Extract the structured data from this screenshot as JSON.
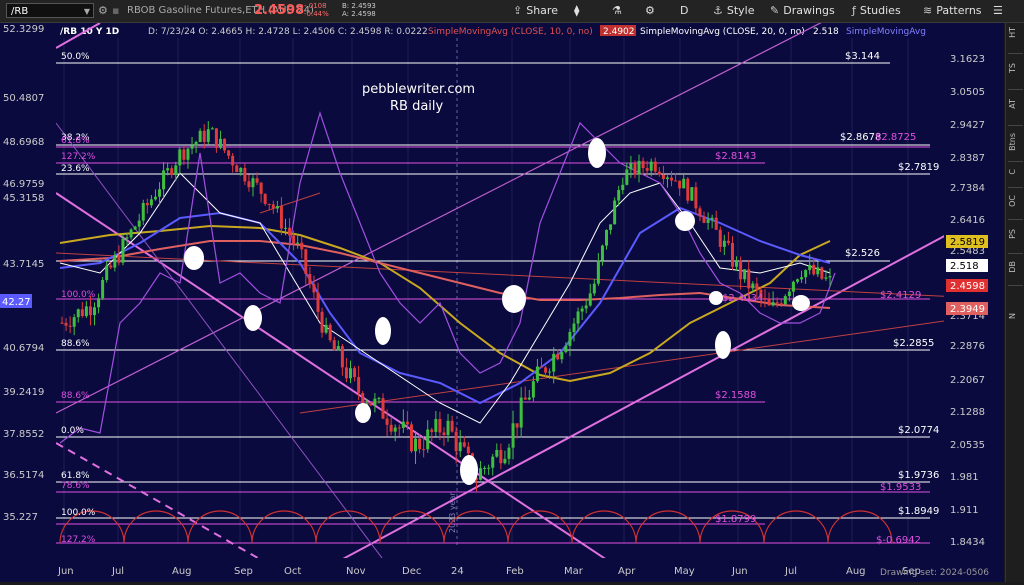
{
  "toolbar": {
    "symbol": "/RB",
    "instrument_title": "RBOB Gasoline Futures,ETH (AUG 24)",
    "last_price": "2.4598",
    "change": "-.0108",
    "change_pct": "-0.44%",
    "bid": "B: 2.4593",
    "ask": "A: 2.4598",
    "share_label": "Share",
    "period_label": "D",
    "style_label": "Style",
    "drawings_label": "Drawings",
    "studies_label": "Studies",
    "patterns_label": "Patterns"
  },
  "chart_header": {
    "symbol_tf": "/RB 10 Y 1D",
    "ohlc": "D: 7/23/24  O: 2.4665  H: 2.4728  L: 2.4506  C: 2.4598  R: 0.0222",
    "sma10": "SimpleMovingAvg (CLOSE, 10, 0, no)",
    "sma10_val": "2.4902",
    "sma20": "SimpleMovingAvg (CLOSE, 20, 0, no)",
    "sma20_val": "2.518",
    "sma_more": "SimpleMovingAvg"
  },
  "watermark": {
    "line1": "pebblewriter.com",
    "line2": "RB daily"
  },
  "chart_data": {
    "type": "candlestick",
    "x_labels": [
      "Jun",
      "Jul",
      "Aug",
      "Sep",
      "Oct",
      "Nov",
      "Dec",
      "24",
      "Feb",
      "Mar",
      "Apr",
      "May",
      "Jun",
      "Jul",
      "Aug",
      "Sep"
    ],
    "right_axis": [
      "3.1623",
      "3.0505",
      "2.9427",
      "2.8387",
      "2.7384",
      "2.6416",
      "2.5483",
      "2.3714",
      "2.2876",
      "2.2067",
      "2.1288",
      "2.0535",
      "1.981",
      "1.911",
      "1.8434"
    ],
    "left_axis": [
      "52.3299",
      "50.4807",
      "48.6968",
      "46.9759",
      "45.3158",
      "43.7145",
      "40.6794",
      "39.2419",
      "37.8552",
      "36.5174",
      "35.227"
    ],
    "left_marker": "42.27",
    "right_badges": {
      "sma_yellow": "2.5819",
      "sma_white": "2.518",
      "last": "2.4598",
      "sma_red": "2.3949"
    },
    "fib_left_labels": [
      "50.0%",
      "38.2%",
      "61.8%",
      "127.2%",
      "23.6%",
      "78.6%",
      "100.0%",
      "88.6%",
      "88.6%",
      "0.0%",
      "61.8%",
      "78.6%",
      "100.0%",
      "127.2%"
    ],
    "level_labels": [
      "$3.144",
      "$2.8678",
      "$2.8725",
      "$2.8143",
      "$2.7819",
      "$2.526",
      "$2.4129",
      "$2.4034",
      "$2.2855",
      "$2.1588",
      "$2.0774",
      "$1.9736",
      "$1.9533",
      "$1.8949",
      "$1.8799",
      "$-0.6942"
    ],
    "close_approx": [
      2.35,
      2.4,
      2.55,
      2.7,
      2.85,
      2.92,
      2.8,
      2.7,
      2.55,
      2.3,
      2.18,
      2.12,
      2.05,
      2.1,
      1.98,
      2.05,
      2.2,
      2.3,
      2.45,
      2.78,
      2.82,
      2.75,
      2.62,
      2.48,
      2.38,
      2.5,
      2.46
    ],
    "vertical_label": "2023 year"
  },
  "footer": {
    "drawing_set": "Drawing set: 2024-0506"
  },
  "sidebar": {
    "tabs": [
      "HT",
      "TS",
      "AT",
      "Btns",
      "C",
      "OC",
      "PS",
      "DB",
      "N"
    ]
  },
  "colors": {
    "bg": "#0a0a3e",
    "up": "#3fbf3f",
    "down": "#e03a3a",
    "sma_red": "#e06060",
    "sma_blue": "#5a5aff",
    "sma_yellow": "#c8a820",
    "purple": "#b060e8",
    "magenta": "#e070e0",
    "white": "#ffffff"
  }
}
